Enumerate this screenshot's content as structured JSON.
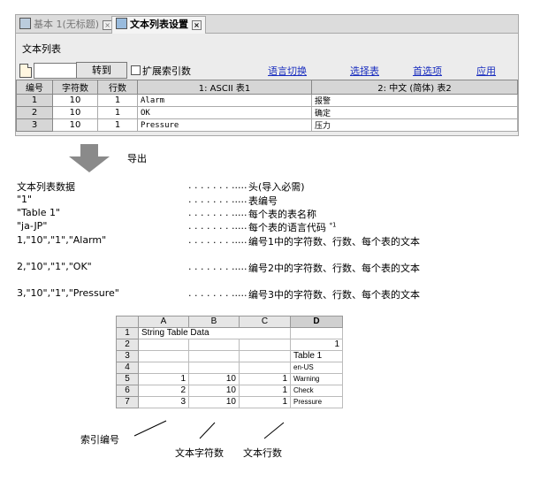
{
  "tabs": [
    {
      "label": "基本 1(无标题)",
      "close": "×"
    },
    {
      "label": "文本列表设置",
      "close": "×"
    }
  ],
  "panel_title": "文本列表",
  "toolbar": {
    "goto_value": "",
    "goto_button": "转到",
    "expand_label": "扩展索引数",
    "links": [
      "语言切换",
      "选择表",
      "首选项",
      "应用"
    ]
  },
  "grid": {
    "headers": [
      "编号",
      "字符数",
      "行数",
      "1: ASCII 表1",
      "2: 中文 (简体) 表2"
    ],
    "rows": [
      [
        "1",
        "10",
        "1",
        "Alarm",
        "报警"
      ],
      [
        "2",
        "10",
        "1",
        "OK",
        "确定"
      ],
      [
        "3",
        "10",
        "1",
        "Pressure",
        "压力"
      ]
    ]
  },
  "export_label": "导出",
  "export_lines": [
    {
      "text": "文本列表数据",
      "dots": ". . . . . . . .....",
      "desc": "头(导入必需)",
      "sup": ""
    },
    {
      "text": "\"1\"",
      "dots": ". . . . . . . .....",
      "desc": "表编号",
      "sup": ""
    },
    {
      "text": "\"Table 1\"",
      "dots": ". . . . . . . .....",
      "desc": "每个表的表名称",
      "sup": ""
    },
    {
      "text": "\"ja-JP\"",
      "dots": ". . . . . . . .....",
      "desc": "每个表的语言代码",
      "sup": "*1"
    },
    {
      "text": "1,\"10\",\"1\",\"Alarm\"",
      "dots": ". . . . . . . .....",
      "desc": "编号1中的字符数、行数、每个表的文本",
      "sup": ""
    },
    {
      "text": "2,\"10\",\"1\",\"OK\"",
      "dots": ". . . . . . . .....",
      "desc": "编号2中的字符数、行数、每个表的文本",
      "sup": ""
    },
    {
      "text": "3,\"10\",\"1\",\"Pressure\"",
      "dots": ". . . . . . . .....",
      "desc": "编号3中的字符数、行数、每个表的文本",
      "sup": ""
    }
  ],
  "sheet": {
    "columns": [
      "A",
      "B",
      "C",
      "D"
    ],
    "rows": [
      {
        "n": "1",
        "a": "String Table Data",
        "b": "",
        "c": "",
        "d": ""
      },
      {
        "n": "2",
        "a": "",
        "b": "",
        "c": "",
        "d": "1"
      },
      {
        "n": "3",
        "a": "",
        "b": "",
        "c": "",
        "d": "Table 1"
      },
      {
        "n": "4",
        "a": "",
        "b": "",
        "c": "",
        "d": "en-US"
      },
      {
        "n": "5",
        "a": "1",
        "b": "10",
        "c": "1",
        "d": "Warning"
      },
      {
        "n": "6",
        "a": "2",
        "b": "10",
        "c": "1",
        "d": "Check"
      },
      {
        "n": "7",
        "a": "3",
        "b": "10",
        "c": "1",
        "d": "Pressure"
      }
    ]
  },
  "annotations": {
    "index_number": "索引编号",
    "char_count": "文本字符数",
    "line_count": "文本行数"
  }
}
